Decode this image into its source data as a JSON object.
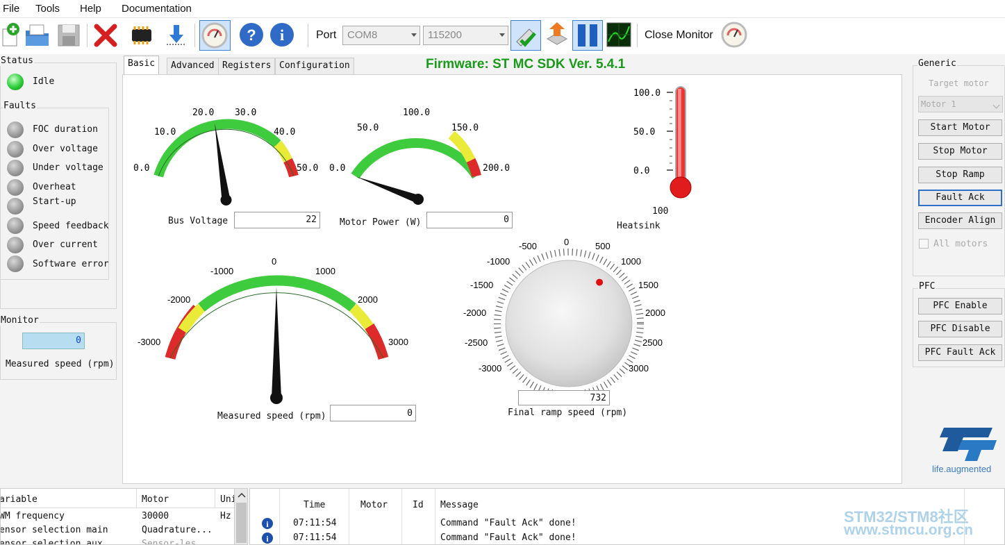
{
  "menu": [
    "File",
    "Tools",
    "Help",
    "Documentation"
  ],
  "toolbar": {
    "port_label": "Port",
    "port_value": "COM8",
    "baud_value": "115200",
    "close_monitor_label": "Close Monitor"
  },
  "firmware": "Firmware: ST MC SDK Ver. 5.4.1",
  "status": {
    "title": "Status",
    "state": "Idle",
    "faults_title": "Faults",
    "faults": [
      "FOC duration",
      "Over voltage",
      "Under voltage",
      "Overheat",
      "Start-up",
      "Speed feedback",
      "Over current",
      "Software error"
    ]
  },
  "monitor": {
    "title": "Monitor",
    "value": "0",
    "label": "Measured speed (rpm)"
  },
  "tabs": [
    "Basic",
    "Advanced",
    "Registers",
    "Configuration"
  ],
  "gauges": {
    "bus_voltage": {
      "label": "Bus Voltage",
      "value": "22",
      "ticks": [
        "0.0",
        "10.0",
        "20.0",
        "30.0",
        "40.0",
        "50.0"
      ],
      "needle": 22,
      "min": 0,
      "max": 50
    },
    "motor_power": {
      "label": "Motor Power (W)",
      "value": "0",
      "ticks": [
        "0.0",
        "50.0",
        "100.0",
        "150.0",
        "200.0"
      ],
      "needle": 0,
      "min": 0,
      "max": 200
    },
    "heatsink": {
      "label": "Heatsink",
      "ticks": [
        "100.0",
        "50.0",
        "0.0"
      ],
      "bottom": "100"
    },
    "measured_speed": {
      "label": "Measured speed (rpm)",
      "value": "0",
      "ticks": [
        "-3000",
        "-2000",
        "-1000",
        "0",
        "1000",
        "2000",
        "3000"
      ],
      "needle": 0,
      "min": -3000,
      "max": 3000
    },
    "final_ramp": {
      "label": "Final ramp speed (rpm)",
      "value": "732",
      "ticks": [
        "-500",
        "0",
        "500",
        "1000",
        "1500",
        "2000",
        "2500",
        "3000",
        "-3000",
        "-2500",
        "-2000",
        "-1500",
        "-1000"
      ],
      "knob": 732
    }
  },
  "generic": {
    "title": "Generic",
    "target_motor_label": "Target motor",
    "target_motor_value": "Motor 1",
    "buttons": [
      "Start Motor",
      "Stop Motor",
      "Stop Ramp",
      "Fault Ack",
      "Encoder Align"
    ],
    "all_motors": "All motors"
  },
  "pfc": {
    "title": "PFC",
    "buttons": [
      "PFC Enable",
      "PFC Disable",
      "PFC Fault Ack"
    ]
  },
  "logo_tagline": "life.augmented",
  "vartable": {
    "headers": [
      "ariable",
      "Motor",
      "Uni"
    ],
    "rows": [
      [
        "WM frequency",
        "30000",
        "Hz"
      ],
      [
        "ensor selection main",
        "Quadrature...",
        ""
      ],
      [
        "ensor selection aux",
        "Sensor-les",
        ""
      ]
    ]
  },
  "log": {
    "headers": [
      "Time",
      "Motor",
      "Id",
      "Message"
    ],
    "rows": [
      {
        "time": "07:11:54",
        "motor": "",
        "id": "",
        "message": "Command \"Fault Ack\" done!"
      },
      {
        "time": "07:11:54",
        "motor": "",
        "id": "",
        "message": "Command \"Fault Ack\" done!"
      }
    ]
  },
  "watermark": {
    "line1": "STM32/STM8社区",
    "line2": "www.stmcu.org.cn"
  }
}
